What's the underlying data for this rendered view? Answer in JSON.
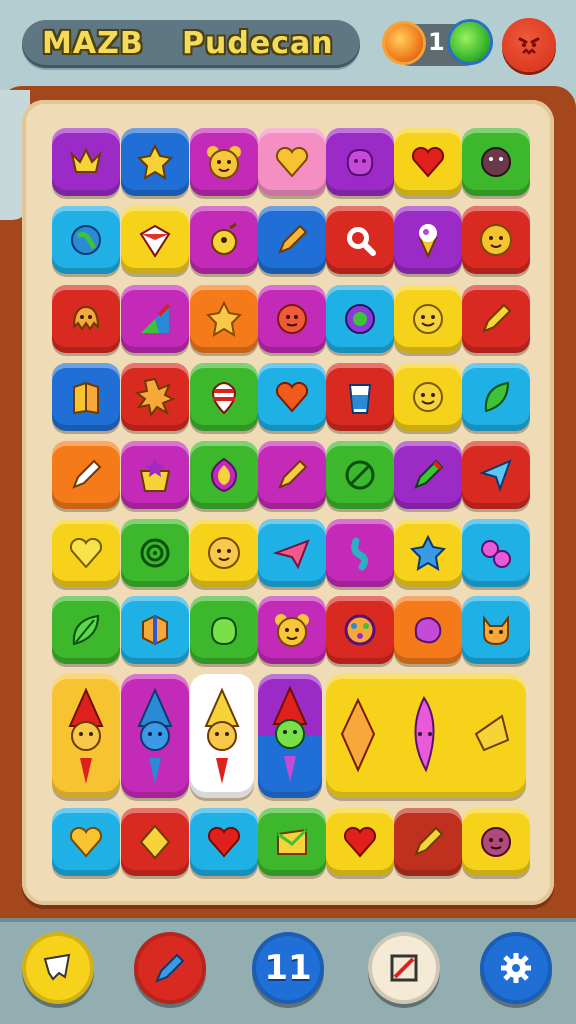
{
  "header": {
    "title_left": "MAZB",
    "title_right": "Pudecan",
    "counter": "1"
  },
  "board": {
    "colors": {
      "purple": "#9b2ac7",
      "blue": "#1f6fd6",
      "magenta": "#c42ab8",
      "pink": "#f58fc3",
      "yellow": "#f6d21a",
      "green": "#3db82c",
      "cyan": "#1fb0e6",
      "red": "#d92a22",
      "orange": "#f47a1a"
    }
  },
  "bottom_bar": {
    "pause_label": "11"
  }
}
